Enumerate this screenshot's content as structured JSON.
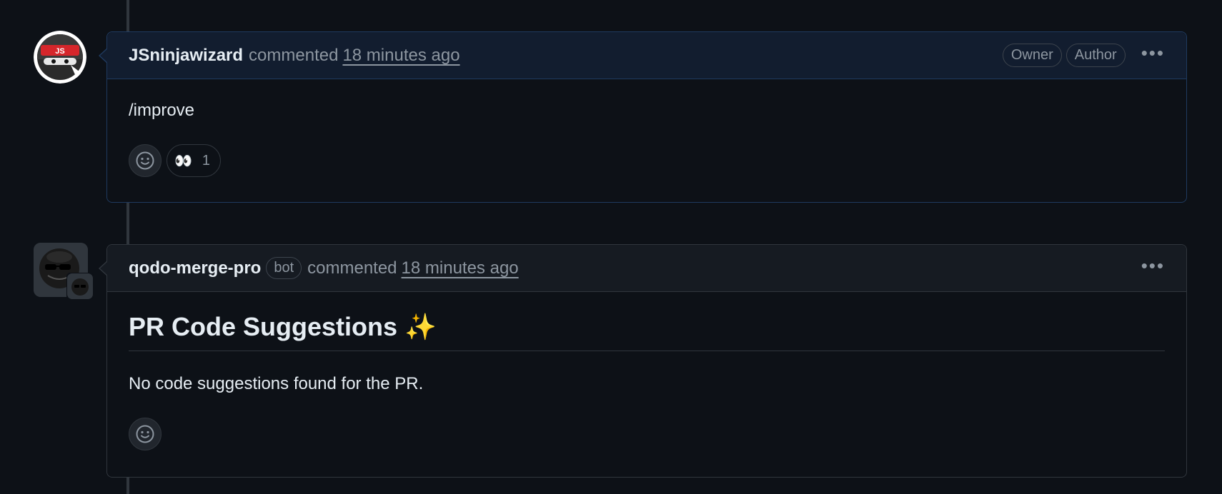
{
  "comments": [
    {
      "author": "JSninjawizard",
      "action": "commented",
      "time": "18 minutes ago",
      "labels": [
        "Owner",
        "Author"
      ],
      "body": "/improve",
      "reactions": [
        {
          "emoji": "👀",
          "count": "1"
        }
      ]
    },
    {
      "author": "qodo-merge-pro",
      "bot_label": "bot",
      "action": "commented",
      "time": "18 minutes ago",
      "heading": "PR Code Suggestions",
      "heading_emoji": "✨",
      "body": "No code suggestions found for the PR."
    }
  ],
  "icons": {
    "more": "kebab-horizontal-icon",
    "reaction": "smiley-icon"
  },
  "avatar_text": "JS"
}
